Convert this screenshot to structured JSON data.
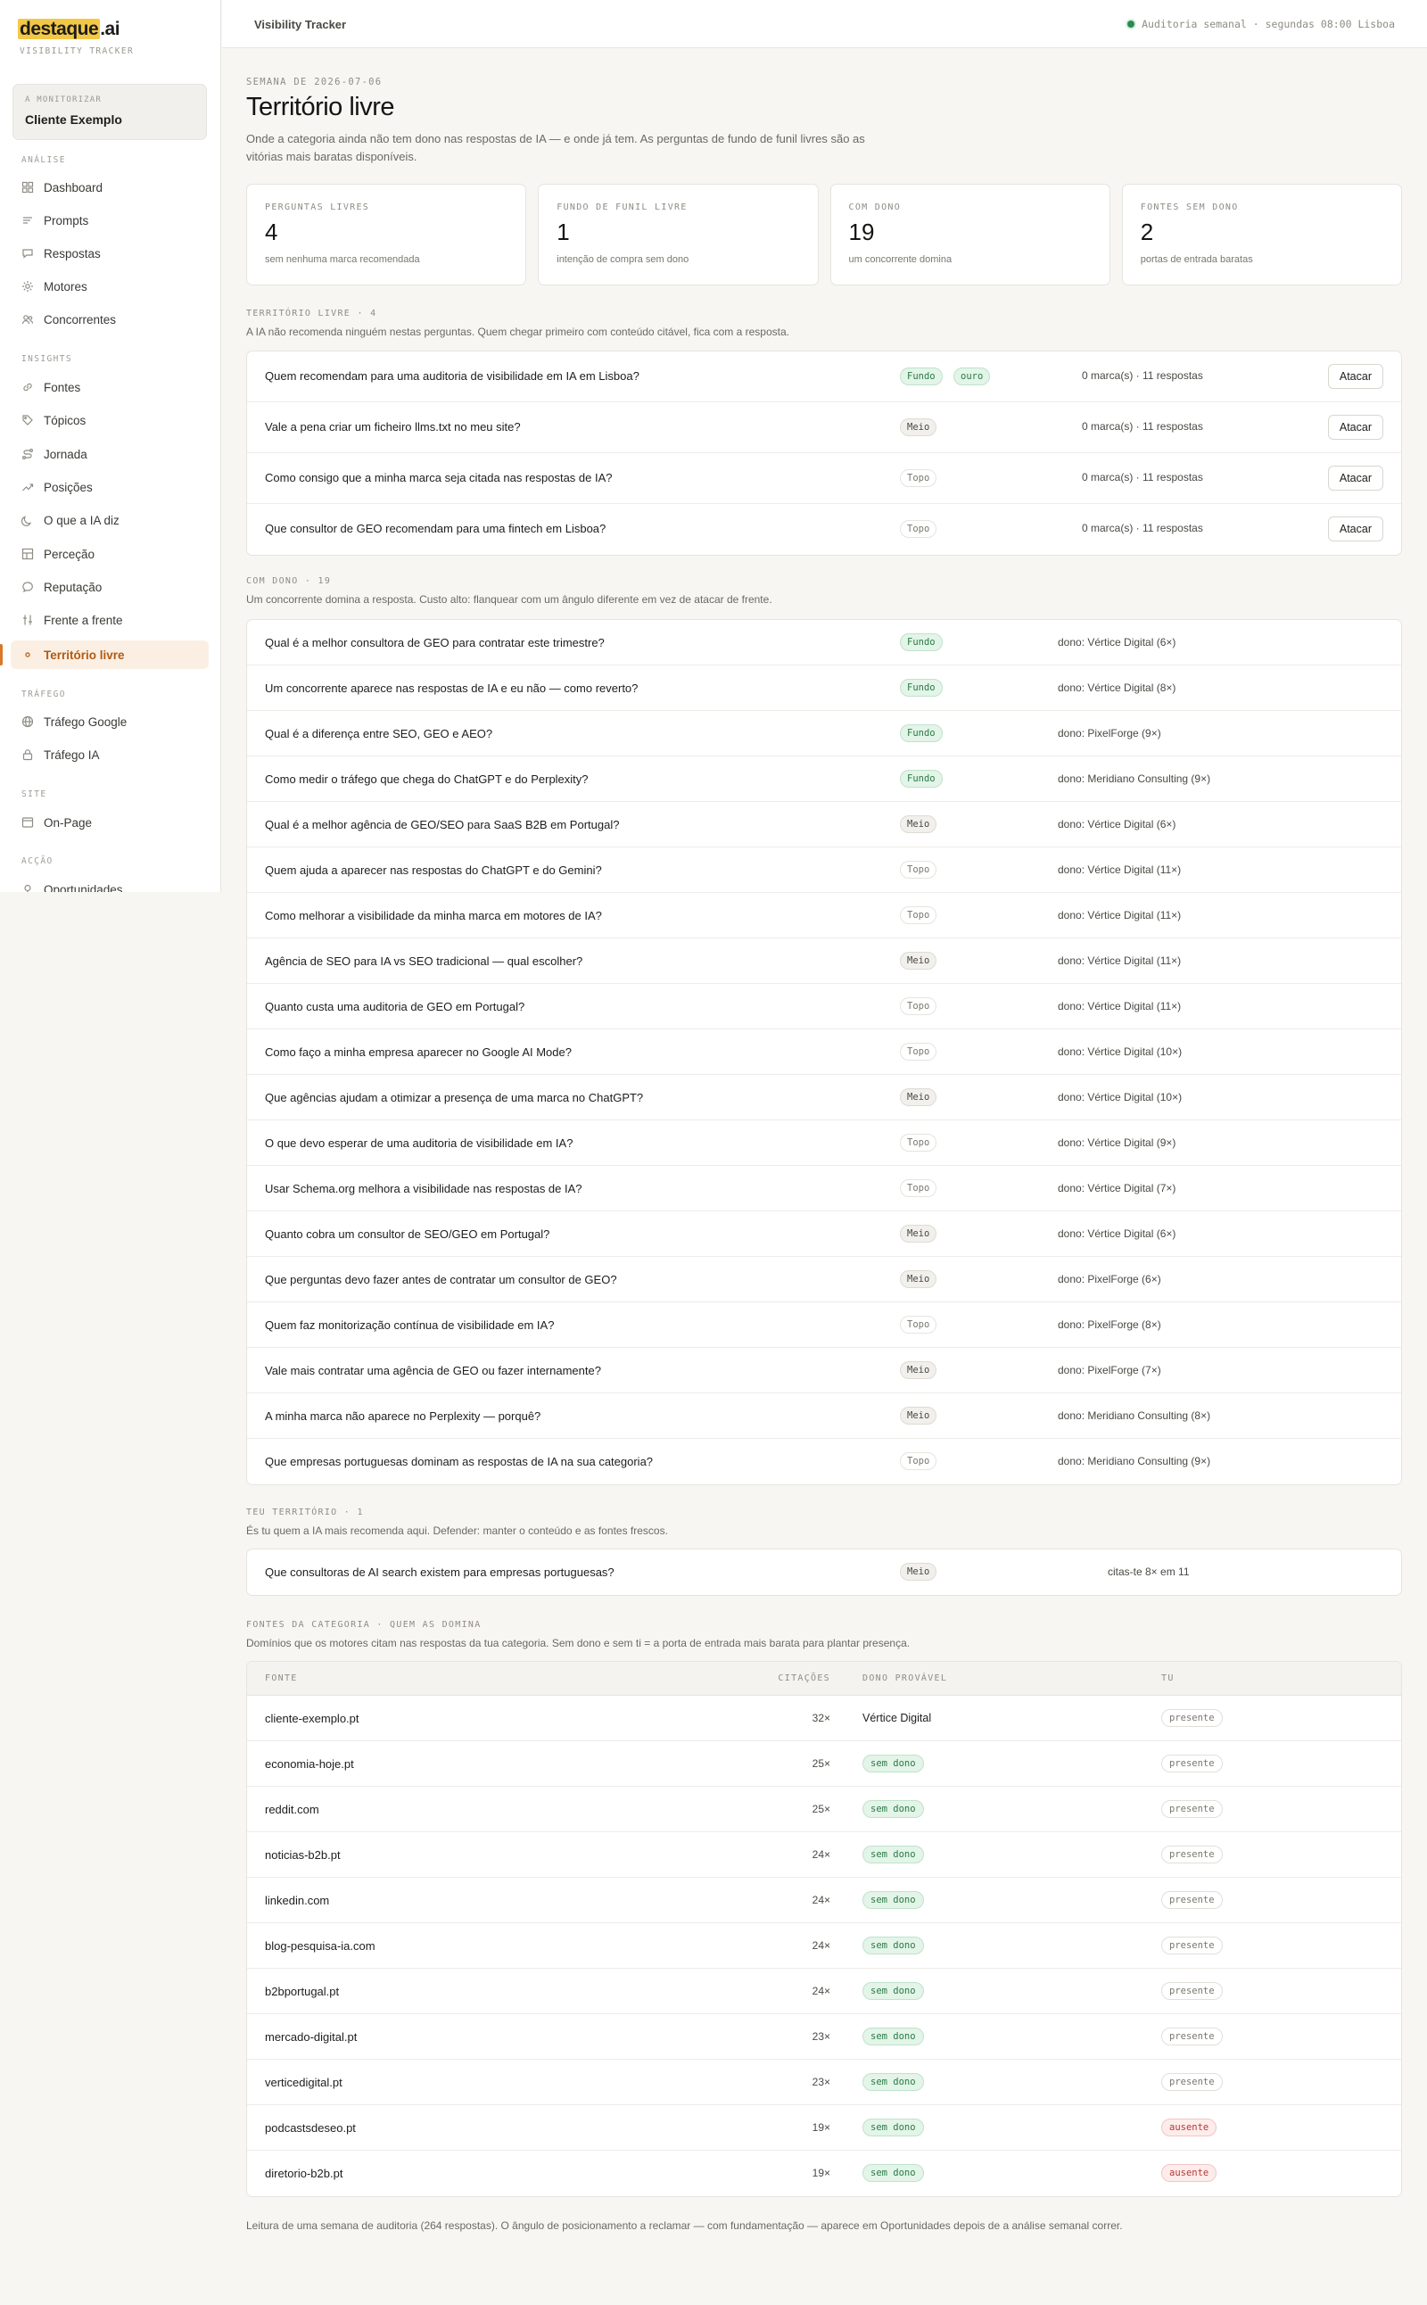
{
  "brand": {
    "logo_main": "destaque",
    "logo_suffix": ".ai",
    "subtitle": "VISIBILITY TRACKER"
  },
  "client": {
    "label": "A MONITORIZAR",
    "name": "Cliente Exemplo"
  },
  "nav": {
    "groups": [
      {
        "label": "ANÁLISE",
        "items": [
          "Dashboard",
          "Prompts",
          "Respostas",
          "Motores",
          "Concorrentes"
        ]
      },
      {
        "label": "INSIGHTS",
        "items": [
          "Fontes",
          "Tópicos",
          "Jornada",
          "Posições",
          "O que a IA diz",
          "Perceção",
          "Reputação",
          "Frente a frente",
          "Território livre"
        ]
      },
      {
        "label": "TRÁFEGO",
        "items": [
          "Tráfego Google",
          "Tráfego IA"
        ]
      },
      {
        "label": "SITE",
        "items": [
          "On-Page"
        ]
      },
      {
        "label": "ACÇÃO",
        "items": [
          "Oportunidades"
        ]
      }
    ],
    "active": "Território livre"
  },
  "topbar": {
    "title": "Visibility Tracker",
    "audit": "Auditoria semanal · segundas 08:00 Lisboa"
  },
  "page": {
    "week": "SEMANA DE 2026-07-06",
    "title": "Território livre",
    "lead": "Onde a categoria ainda não tem dono nas respostas de IA — e onde já tem. As perguntas de fundo de funil livres são as vitórias mais baratas disponíveis."
  },
  "stats": [
    {
      "label": "PERGUNTAS LIVRES",
      "value": "4",
      "sub": "sem nenhuma marca recomendada"
    },
    {
      "label": "FUNDO DE FUNIL LIVRE",
      "value": "1",
      "sub": "intenção de compra sem dono"
    },
    {
      "label": "COM DONO",
      "value": "19",
      "sub": "um concorrente domina"
    },
    {
      "label": "FONTES SEM DONO",
      "value": "2",
      "sub": "portas de entrada baratas"
    }
  ],
  "free": {
    "label": "TERRITÓRIO LIVRE · 4",
    "desc": "A IA não recomenda ninguém nestas perguntas. Quem chegar primeiro com conteúdo citável, fica com a resposta.",
    "action": "Atacar",
    "rows": [
      {
        "q": "Quem recomendam para uma auditoria de visibilidade em IA em Lisboa?",
        "stage": "Fundo",
        "extra": "ouro",
        "meta": "0 marca(s) · 11 respostas"
      },
      {
        "q": "Vale a pena criar um ficheiro llms.txt no meu site?",
        "stage": "Meio",
        "meta": "0 marca(s) · 11 respostas"
      },
      {
        "q": "Como consigo que a minha marca seja citada nas respostas de IA?",
        "stage": "Topo",
        "meta": "0 marca(s) · 11 respostas"
      },
      {
        "q": "Que consultor de GEO recomendam para uma fintech em Lisboa?",
        "stage": "Topo",
        "meta": "0 marca(s) · 11 respostas"
      }
    ]
  },
  "owned": {
    "label": "COM DONO · 19",
    "desc": "Um concorrente domina a resposta. Custo alto: flanquear com um ângulo diferente em vez de atacar de frente.",
    "rows": [
      {
        "q": "Qual é a melhor consultora de GEO para contratar este trimestre?",
        "stage": "Fundo",
        "owner": "dono: Vértice Digital (6×)"
      },
      {
        "q": "Um concorrente aparece nas respostas de IA e eu não — como reverto?",
        "stage": "Fundo",
        "owner": "dono: Vértice Digital (8×)"
      },
      {
        "q": "Qual é a diferença entre SEO, GEO e AEO?",
        "stage": "Fundo",
        "owner": "dono: PixelForge (9×)"
      },
      {
        "q": "Como medir o tráfego que chega do ChatGPT e do Perplexity?",
        "stage": "Fundo",
        "owner": "dono: Meridiano Consulting (9×)"
      },
      {
        "q": "Qual é a melhor agência de GEO/SEO para SaaS B2B em Portugal?",
        "stage": "Meio",
        "owner": "dono: Vértice Digital (6×)"
      },
      {
        "q": "Quem ajuda a aparecer nas respostas do ChatGPT e do Gemini?",
        "stage": "Topo",
        "owner": "dono: Vértice Digital (11×)"
      },
      {
        "q": "Como melhorar a visibilidade da minha marca em motores de IA?",
        "stage": "Topo",
        "owner": "dono: Vértice Digital (11×)"
      },
      {
        "q": "Agência de SEO para IA vs SEO tradicional — qual escolher?",
        "stage": "Meio",
        "owner": "dono: Vértice Digital (11×)"
      },
      {
        "q": "Quanto custa uma auditoria de GEO em Portugal?",
        "stage": "Topo",
        "owner": "dono: Vértice Digital (11×)"
      },
      {
        "q": "Como faço a minha empresa aparecer no Google AI Mode?",
        "stage": "Topo",
        "owner": "dono: Vértice Digital (10×)"
      },
      {
        "q": "Que agências ajudam a otimizar a presença de uma marca no ChatGPT?",
        "stage": "Meio",
        "owner": "dono: Vértice Digital (10×)"
      },
      {
        "q": "O que devo esperar de uma auditoria de visibilidade em IA?",
        "stage": "Topo",
        "owner": "dono: Vértice Digital (9×)"
      },
      {
        "q": "Usar Schema.org melhora a visibilidade nas respostas de IA?",
        "stage": "Topo",
        "owner": "dono: Vértice Digital (7×)"
      },
      {
        "q": "Quanto cobra um consultor de SEO/GEO em Portugal?",
        "stage": "Meio",
        "owner": "dono: Vértice Digital (6×)"
      },
      {
        "q": "Que perguntas devo fazer antes de contratar um consultor de GEO?",
        "stage": "Meio",
        "owner": "dono: PixelForge (6×)"
      },
      {
        "q": "Quem faz monitorização contínua de visibilidade em IA?",
        "stage": "Topo",
        "owner": "dono: PixelForge (8×)"
      },
      {
        "q": "Vale mais contratar uma agência de GEO ou fazer internamente?",
        "stage": "Meio",
        "owner": "dono: PixelForge (7×)"
      },
      {
        "q": "A minha marca não aparece no Perplexity — porquê?",
        "stage": "Meio",
        "owner": "dono: Meridiano Consulting (8×)"
      },
      {
        "q": "Que empresas portuguesas dominam as respostas de IA na sua categoria?",
        "stage": "Topo",
        "owner": "dono: Meridiano Consulting (9×)"
      }
    ]
  },
  "yours": {
    "label": "TEU TERRITÓRIO · 1",
    "desc": "És tu quem a IA mais recomenda aqui. Defender: manter o conteúdo e as fontes frescos.",
    "rows": [
      {
        "q": "Que consultoras de AI search existem para empresas portuguesas?",
        "stage": "Meio",
        "meta": "citas-te 8× em 11"
      }
    ]
  },
  "sources": {
    "label": "FONTES DA CATEGORIA · QUEM AS DOMINA",
    "desc": "Domínios que os motores citam nas respostas da tua categoria. Sem dono e sem ti = a porta de entrada mais barata para plantar presença.",
    "headers": {
      "source": "FONTE",
      "citations": "CITAÇÕES",
      "owner": "DONO PROVÁVEL",
      "you": "TU"
    },
    "rows": [
      {
        "domain": "cliente-exemplo.pt",
        "citations": "32×",
        "owner": "Vértice Digital",
        "owner_is_tag": false,
        "you": "presente"
      },
      {
        "domain": "economia-hoje.pt",
        "citations": "25×",
        "owner": "sem dono",
        "owner_is_tag": true,
        "you": "presente"
      },
      {
        "domain": "reddit.com",
        "citations": "25×",
        "owner": "sem dono",
        "owner_is_tag": true,
        "you": "presente"
      },
      {
        "domain": "noticias-b2b.pt",
        "citations": "24×",
        "owner": "sem dono",
        "owner_is_tag": true,
        "you": "presente"
      },
      {
        "domain": "linkedin.com",
        "citations": "24×",
        "owner": "sem dono",
        "owner_is_tag": true,
        "you": "presente"
      },
      {
        "domain": "blog-pesquisa-ia.com",
        "citations": "24×",
        "owner": "sem dono",
        "owner_is_tag": true,
        "you": "presente"
      },
      {
        "domain": "b2bportugal.pt",
        "citations": "24×",
        "owner": "sem dono",
        "owner_is_tag": true,
        "you": "presente"
      },
      {
        "domain": "mercado-digital.pt",
        "citations": "23×",
        "owner": "sem dono",
        "owner_is_tag": true,
        "you": "presente"
      },
      {
        "domain": "verticedigital.pt",
        "citations": "23×",
        "owner": "sem dono",
        "owner_is_tag": true,
        "you": "presente"
      },
      {
        "domain": "podcastsdeseo.pt",
        "citations": "19×",
        "owner": "sem dono",
        "owner_is_tag": true,
        "you": "ausente"
      },
      {
        "domain": "diretorio-b2b.pt",
        "citations": "19×",
        "owner": "sem dono",
        "owner_is_tag": true,
        "you": "ausente"
      }
    ]
  },
  "footer": "Leitura de uma semana de auditoria (264 respostas). O ângulo de posicionamento a reclamar — com fundamentação — aparece em Oportunidades depois de a análise semanal correr.",
  "colors": {
    "accent": "#d7782a",
    "logo_highlight": "#f3c847",
    "green": "#2a7a46",
    "red": "#b23a35"
  }
}
